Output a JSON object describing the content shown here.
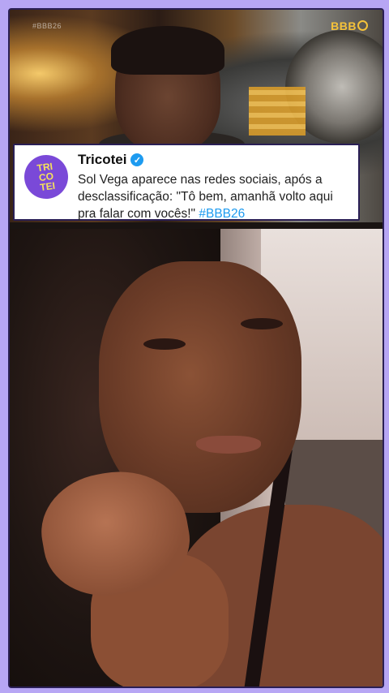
{
  "top_video": {
    "watermark": "#BBB26",
    "logo": "BBB"
  },
  "tweet": {
    "avatar_text": [
      "TRI",
      "CO",
      "TEI"
    ],
    "name": "Tricotei",
    "verified_icon": "verified-badge-icon",
    "text": "Sol Vega aparece nas redes sociais, após a desclassificação: \"Tô bem, amanhã volto aqui pra falar com vocês!\" ",
    "hashtag": "#BBB26"
  },
  "colors": {
    "background": "#b7a6f4",
    "frame_border": "#2a1f55",
    "avatar_bg": "#7a49d8",
    "avatar_text": "#f6e25a",
    "link": "#1d9bf0"
  }
}
